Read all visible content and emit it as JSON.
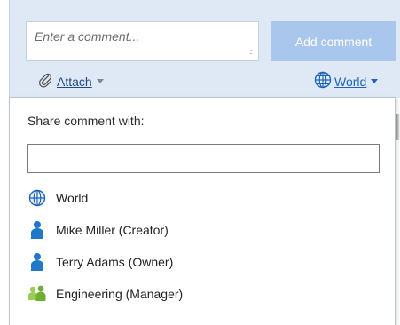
{
  "editor": {
    "comment_placeholder": "Enter a comment...",
    "resize_grip": ".::",
    "add_button_label": "Add comment",
    "attach_label": "Attach",
    "visibility_label": "World"
  },
  "share": {
    "title": "Share comment with:",
    "search_value": "",
    "options": [
      {
        "label": "World",
        "icon": "globe-icon"
      },
      {
        "label": "Mike Miller (Creator)",
        "icon": "user-icon"
      },
      {
        "label": "Terry Adams (Owner)",
        "icon": "user-icon"
      },
      {
        "label": "Engineering (Manager)",
        "icon": "group-icon"
      }
    ]
  },
  "colors": {
    "editor_bg": "#dfe8f5",
    "add_button_bg": "#a9c6ec",
    "link_blue": "#1e63b8",
    "user_icon_blue": "#1f78c8",
    "group_icon_green": "#7fbf3f"
  }
}
